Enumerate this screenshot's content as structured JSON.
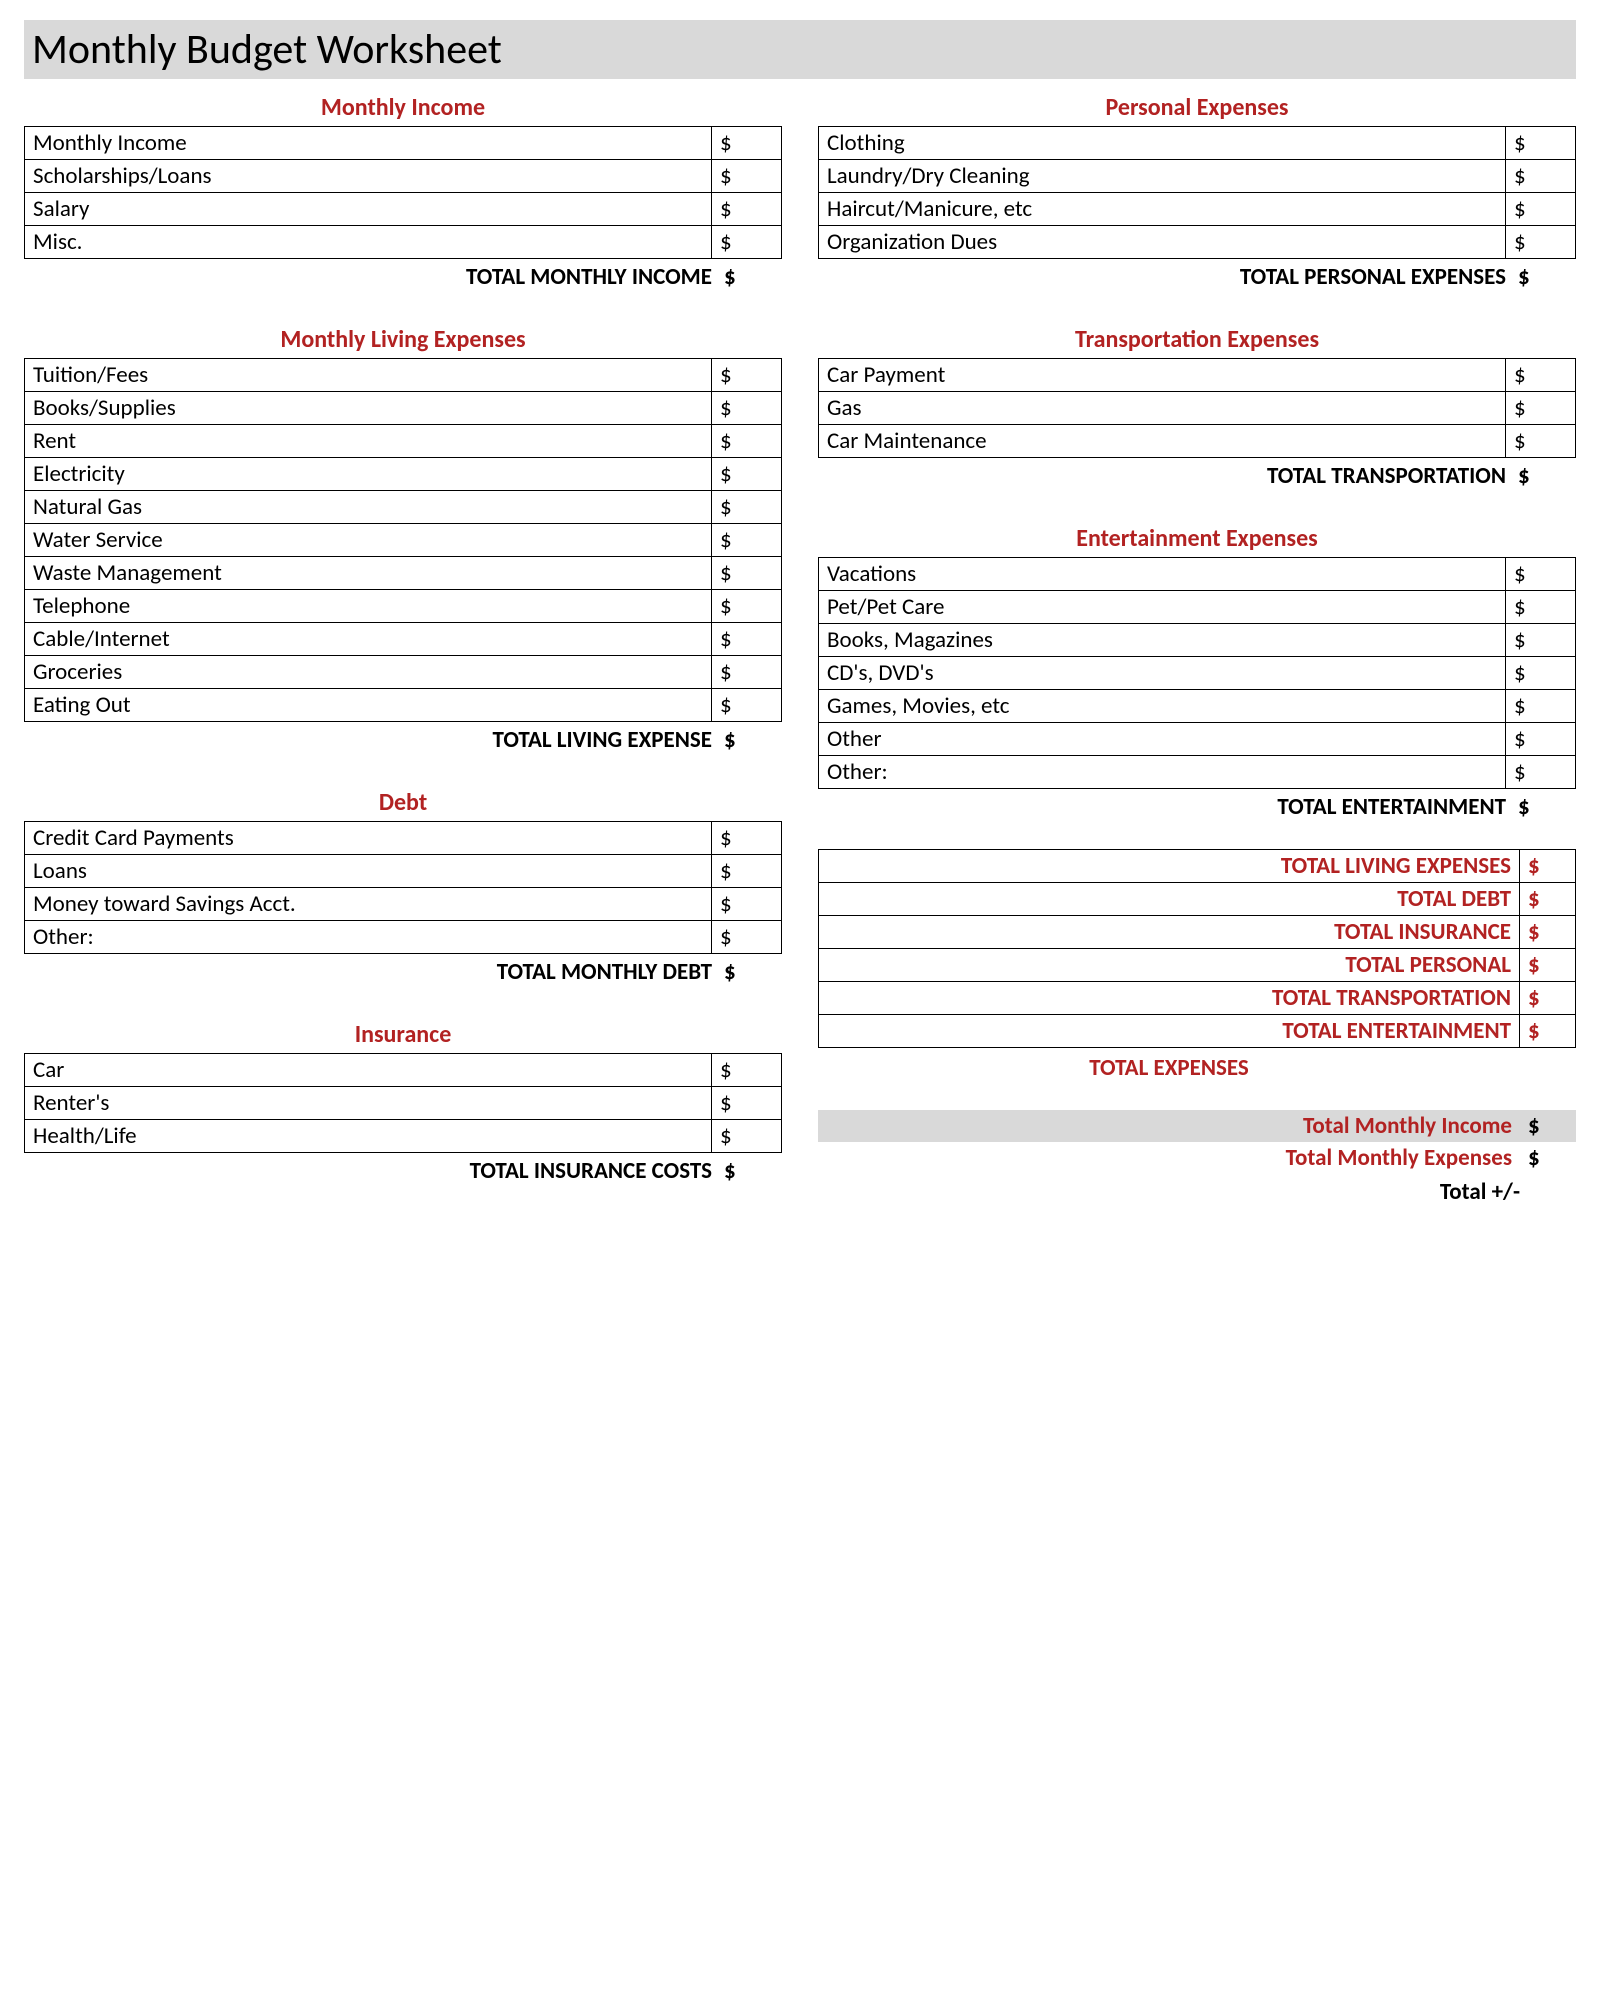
{
  "title": "Monthly Budget Worksheet",
  "currency": "$",
  "sections": {
    "income": {
      "title": "Monthly Income",
      "rows": [
        "Monthly Income",
        "Scholarships/Loans",
        "Salary",
        "Misc."
      ],
      "total": "TOTAL MONTHLY INCOME"
    },
    "living": {
      "title": "Monthly Living Expenses",
      "rows": [
        "Tuition/Fees",
        "Books/Supplies",
        "Rent",
        "Electricity",
        "Natural Gas",
        "Water Service",
        "Waste Management",
        "Telephone",
        "Cable/Internet",
        "Groceries",
        "Eating Out"
      ],
      "total": "TOTAL LIVING EXPENSE"
    },
    "debt": {
      "title": "Debt",
      "rows": [
        "Credit Card Payments",
        "Loans",
        "Money toward Savings Acct.",
        "Other:"
      ],
      "total": "TOTAL MONTHLY DEBT"
    },
    "insurance": {
      "title": "Insurance",
      "rows": [
        "Car",
        "Renter's",
        "Health/Life"
      ],
      "total": "TOTAL INSURANCE COSTS"
    },
    "personal": {
      "title": "Personal Expenses",
      "rows": [
        "Clothing",
        "Laundry/Dry Cleaning",
        "Haircut/Manicure, etc",
        "Organization Dues"
      ],
      "total": "TOTAL PERSONAL EXPENSES"
    },
    "transportation": {
      "title": "Transportation Expenses",
      "rows": [
        "Car Payment",
        "Gas",
        "Car Maintenance"
      ],
      "total": "TOTAL TRANSPORTATION"
    },
    "entertainment": {
      "title": "Entertainment Expenses",
      "rows": [
        "Vacations",
        "Pet/Pet Care",
        "Books, Magazines",
        "CD's, DVD's",
        "Games, Movies, etc",
        "Other",
        "Other:"
      ],
      "total": "TOTAL ENTERTAINMENT"
    }
  },
  "summary": {
    "rows": [
      "TOTAL LIVING EXPENSES",
      "TOTAL DEBT",
      "TOTAL INSURANCE",
      "TOTAL PERSONAL",
      "TOTAL TRANSPORTATION",
      "TOTAL ENTERTAINMENT"
    ],
    "total": "TOTAL EXPENSES"
  },
  "final": {
    "income": "Total Monthly Income",
    "expenses": "Total Monthly Expenses",
    "net": "Total +/-"
  }
}
